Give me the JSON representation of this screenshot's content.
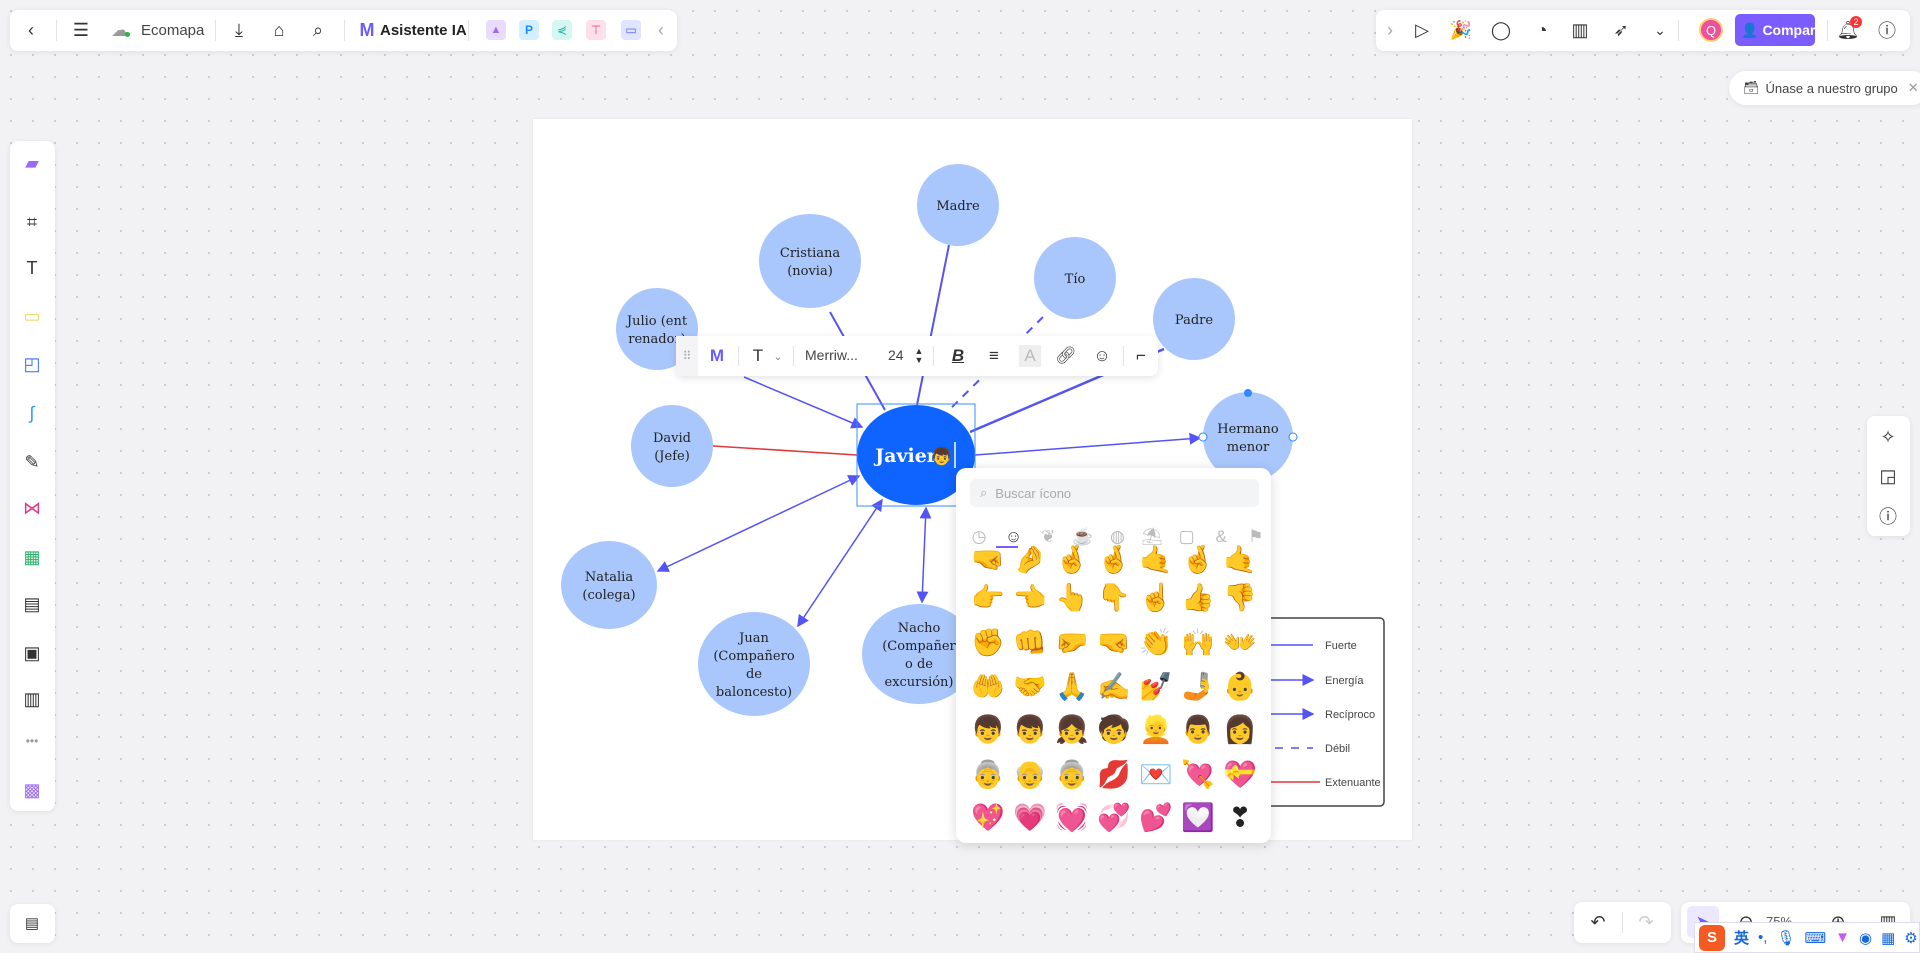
{
  "topbar": {
    "file_name": "Ecomapa",
    "ai_label": "Asistente IA",
    "share_label": "Compartir",
    "avatar_letter": "Q",
    "notification_count": "2",
    "icons": [
      "back-icon",
      "menu-icon",
      "cloud-icon",
      "download-icon",
      "tag-icon",
      "search-icon",
      "ai-logo-icon",
      "image-ai-icon",
      "p-app-icon",
      "mindmap-app-icon",
      "flow-app-icon",
      "chat-app-icon",
      "collapse-icon"
    ],
    "right_icons": [
      "expand-icon",
      "play-icon",
      "celebrate-icon",
      "comment-icon",
      "timer-icon",
      "chart-icon",
      "laser-pointer-icon",
      "more-icon",
      "bell-icon",
      "help-icon"
    ]
  },
  "banner": {
    "text": "Únase a nuestro grupo"
  },
  "left_tools": [
    "template-icon",
    "frame-icon",
    "text-icon",
    "sticky-note-icon",
    "shape-icon",
    "connector-icon",
    "pen-icon",
    "mindmap-icon",
    "table-icon",
    "document-icon",
    "cards-icon",
    "kanban-icon",
    "more-icon",
    "plugins-icon"
  ],
  "text_toolbar": {
    "font": "Merriw...",
    "size": "24"
  },
  "diagram": {
    "center": {
      "label": "Javier",
      "emoji": "👦"
    },
    "nodes": {
      "madre": [
        "Madre"
      ],
      "cristiana": [
        "Cristiana",
        "(novia)"
      ],
      "tio": [
        "Tío"
      ],
      "padre": [
        "Padre"
      ],
      "julio": [
        "Julio (ent",
        "renador)"
      ],
      "david": [
        "David",
        "(Jefe)"
      ],
      "hermano": [
        "Hermano",
        "menor"
      ],
      "natalia": [
        "Natalia",
        "(colega)"
      ],
      "juan": [
        "Juan",
        "(Compañero",
        "de",
        "baloncesto)"
      ],
      "nacho": [
        "Nacho",
        "(Compañer",
        "o de",
        "excursión)"
      ]
    },
    "colors": {
      "node": "#a9c7fd",
      "center": "#0f63ff",
      "edge": "#5454f5",
      "weak_edge": "#5454f5",
      "stress_edge": "#e0393b"
    },
    "legend": [
      "Fuerte",
      "Energía",
      "Recíproco",
      "Débil",
      "Extenuante"
    ]
  },
  "emoji_panel": {
    "search_placeholder": "Buscar ícono",
    "categories": [
      "recent-icon",
      "smiley-icon",
      "nature-icon",
      "food-icon",
      "activity-icon",
      "travel-icon",
      "objects-icon",
      "symbols-icon",
      "flag-icon"
    ],
    "active_category": "smiley",
    "rows": [
      [
        "🤜",
        "🤌",
        "🤞",
        "🤞",
        "🤙",
        "🤞",
        "🤙"
      ],
      [
        "👉",
        "👈",
        "👆",
        "👇",
        "☝",
        "👍",
        "👎"
      ],
      [
        "✊",
        "👊",
        "🤛",
        "🤜",
        "👏",
        "🙌",
        "👐"
      ],
      [
        "🤲",
        "🤝",
        "🙏",
        "✍",
        "💅",
        "🤳",
        "👶"
      ],
      [
        "👦",
        "👦",
        "👧",
        "🧒",
        "👱",
        "👨",
        "👩"
      ],
      [
        "👵",
        "👴",
        "👵",
        "💋",
        "💌",
        "💘",
        "💝"
      ],
      [
        "💖",
        "💗",
        "💓",
        "💞",
        "💕",
        "💟",
        "❣"
      ]
    ]
  },
  "zoom": {
    "level": "75%"
  },
  "ime": {
    "lang": "英",
    "punct": "•,"
  }
}
